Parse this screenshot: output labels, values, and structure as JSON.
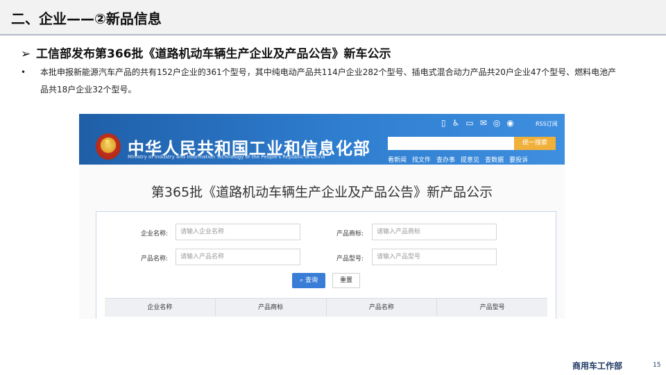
{
  "slide": {
    "title": "二、企业——②新品信息",
    "heading_arrow": "➢",
    "heading": "工信部发布第366批《道路机动车辆生产企业及产品公告》新车公示",
    "bullet_dot": "•",
    "bullet": "本批申报新能源汽车产品的共有152户企业的361个型号，其中纯电动产品共114户企业282个型号、插电式混合动力产品共20户企业47个型号、燃料电池产品共18户企业32个型号。",
    "footer_name": "商用车工作部",
    "page_number": "15"
  },
  "screenshot": {
    "ministry_cn": "中华人民共和国工业和信息化部",
    "ministry_en": "Ministry of Industry and Information Technology of the People's Republic of China",
    "top_icons": [
      "mobile-icon",
      "accessibility-icon",
      "phone-icon",
      "mail-icon",
      "wechat-icon",
      "weibo-icon"
    ],
    "rss_label": "RSS订阅",
    "search_button": "统一搜索",
    "nav": [
      "看新闻",
      "找文件",
      "查办事",
      "提意见",
      "查数据",
      "要投诉"
    ],
    "page_title": "第365批《道路机动车辆生产企业及产品公告》新产品公示",
    "form": {
      "company_label": "企业名称:",
      "company_placeholder": "请输入企业名称",
      "brand_label": "产品商标:",
      "brand_placeholder": "请输入产品商标",
      "product_label": "产品名称:",
      "product_placeholder": "请输入产品名称",
      "model_label": "产品型号:",
      "model_placeholder": "请输入产品型号",
      "query_button": "查询",
      "reset_button": "重置"
    },
    "table_headers": [
      "企业名称",
      "产品商标",
      "产品名称",
      "产品型号"
    ]
  },
  "colors": {
    "banner": "#2f7ed0",
    "accent": "#f0b03a",
    "query": "#3a7dd6",
    "footer": "#1f3864"
  }
}
